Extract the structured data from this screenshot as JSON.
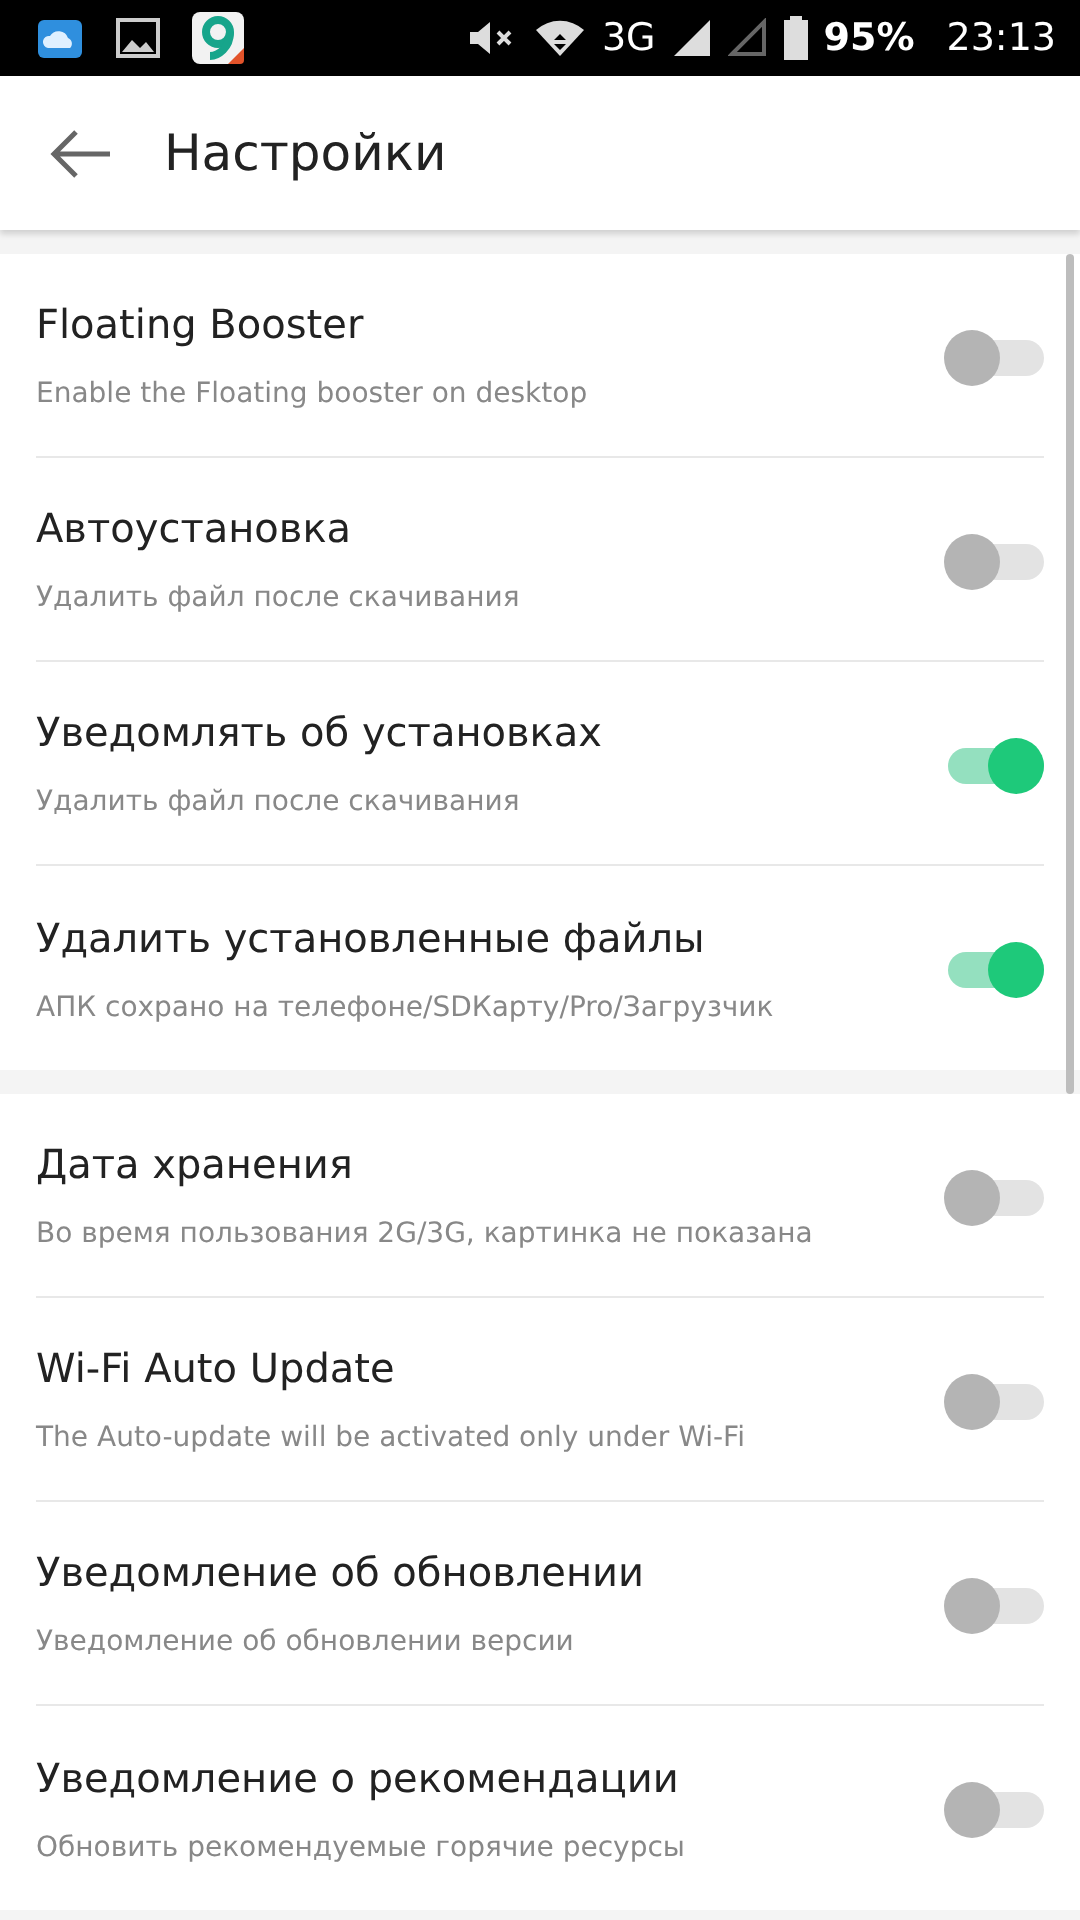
{
  "status_bar": {
    "signal_text": "3G",
    "battery": "95%",
    "time": "23:13"
  },
  "header": {
    "title": "Настройки"
  },
  "groups": [
    {
      "items": [
        {
          "title": "Floating Booster",
          "subtitle": "Enable the Floating booster on desktop",
          "on": false
        },
        {
          "title": "Автоустановка",
          "subtitle": "Удалить файл после скачивания",
          "on": false
        },
        {
          "title": "Уведомлять об установках",
          "subtitle": "Удалить файл после скачивания",
          "on": true
        },
        {
          "title": "Удалить установленные файлы",
          "subtitle": "АПК сохрано на телефоне/SDКарту/Pro/Загрузчик",
          "on": true
        }
      ]
    },
    {
      "items": [
        {
          "title": "Дата хранения",
          "subtitle": "Во время пользования 2G/3G, картинка не показана",
          "on": false
        },
        {
          "title": "Wi-Fi Auto Update",
          "subtitle": "The Auto-update will be activated only under Wi-Fi",
          "on": false
        },
        {
          "title": "Уведомление об обновлении",
          "subtitle": "Уведомление об обновлении версии",
          "on": false
        },
        {
          "title": "Уведомление о рекомендации",
          "subtitle": "Обновить рекомендуемые горячие ресурсы",
          "on": false
        }
      ]
    }
  ]
}
